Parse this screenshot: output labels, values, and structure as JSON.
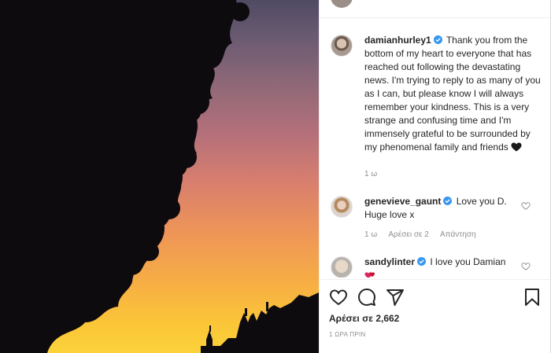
{
  "post": {
    "author": "damianhurley1",
    "caption": "Thank you from the bottom of my heart to everyone that has reached out following the devastating news. I'm trying to reply to as many of you as I can, but please know I will always remember your kindness. This is a very strange and confusing time and I'm immensely grateful to be surrounded by my phenomenal family and friends",
    "caption_time": "1 ω"
  },
  "comments": [
    {
      "user": "genevieve_gaunt",
      "text": "Love you D. Huge love x",
      "time": "1 ω",
      "likes": "Αρέσει σε 2",
      "reply": "Απάντηση"
    },
    {
      "user": "sandylinter",
      "text": "I love you Damian"
    }
  ],
  "footer": {
    "likes": "Αρέσει σε 2,662",
    "time": "1 ΩΡΑ ΠΡΙΝ"
  },
  "icons": {
    "like": "heart-outline-icon",
    "comment": "speech-bubble-icon",
    "share": "paper-plane-icon",
    "save": "bookmark-icon",
    "verified": "verified-badge-icon",
    "emoji": "black-heart-emoji"
  },
  "colors": {
    "verified": "#3897f0",
    "muted": "#8e8e8e",
    "text": "#262626"
  }
}
